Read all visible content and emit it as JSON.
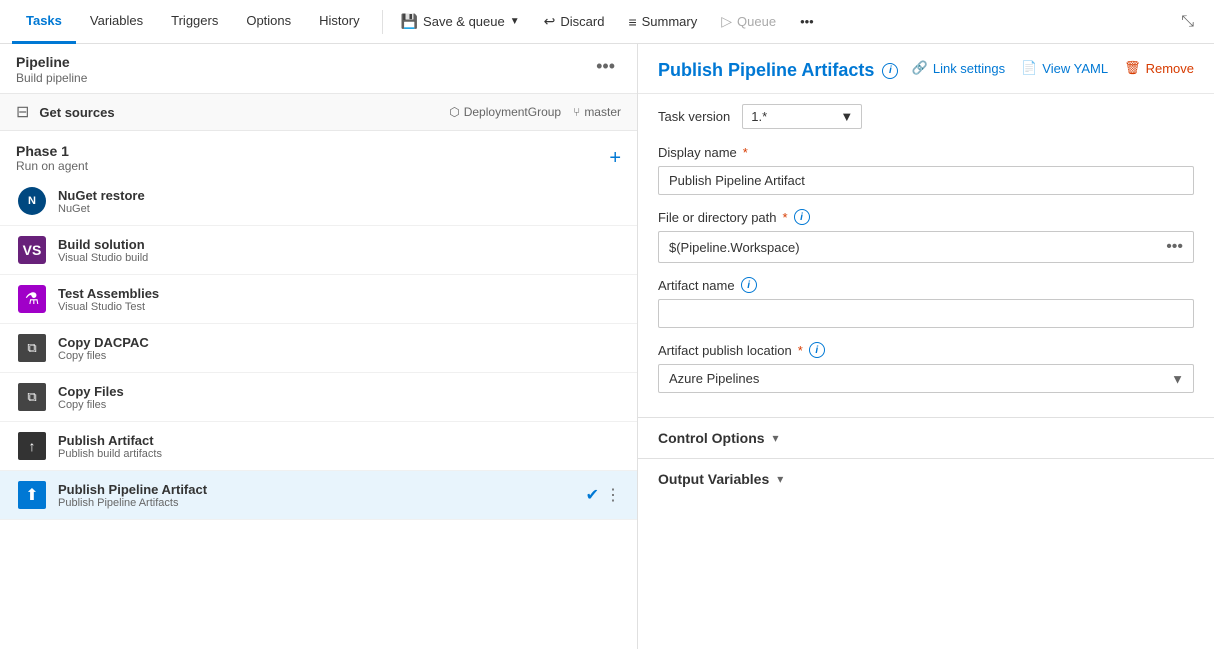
{
  "topNav": {
    "tabs": [
      {
        "id": "tasks",
        "label": "Tasks",
        "active": true
      },
      {
        "id": "variables",
        "label": "Variables",
        "active": false
      },
      {
        "id": "triggers",
        "label": "Triggers",
        "active": false
      },
      {
        "id": "options",
        "label": "Options",
        "active": false
      },
      {
        "id": "history",
        "label": "History",
        "active": false
      }
    ],
    "actions": [
      {
        "id": "save-queue",
        "icon": "💾",
        "label": "Save & queue",
        "hasDropdown": true
      },
      {
        "id": "discard",
        "icon": "↩",
        "label": "Discard"
      },
      {
        "id": "summary",
        "icon": "≡",
        "label": "Summary"
      },
      {
        "id": "queue",
        "icon": "▷",
        "label": "Queue"
      },
      {
        "id": "more",
        "icon": "···",
        "label": ""
      }
    ]
  },
  "leftPanel": {
    "pipeline": {
      "title": "Pipeline",
      "subtitle": "Build pipeline"
    },
    "getSources": {
      "label": "Get sources",
      "repo": "DeploymentGroup",
      "branch": "master"
    },
    "phase": {
      "title": "Phase 1",
      "subtitle": "Run on agent"
    },
    "tasks": [
      {
        "id": "nuget",
        "name": "NuGet restore",
        "sub": "NuGet",
        "iconType": "nuget"
      },
      {
        "id": "build",
        "name": "Build solution",
        "sub": "Visual Studio build",
        "iconType": "vs"
      },
      {
        "id": "test",
        "name": "Test Assemblies",
        "sub": "Visual Studio Test",
        "iconType": "flask"
      },
      {
        "id": "copy-dacpac",
        "name": "Copy DACPAC",
        "sub": "Copy files",
        "iconType": "copy"
      },
      {
        "id": "copy-files",
        "name": "Copy Files",
        "sub": "Copy files",
        "iconType": "copy"
      },
      {
        "id": "publish-artifact",
        "name": "Publish Artifact",
        "sub": "Publish build artifacts",
        "iconType": "publish"
      },
      {
        "id": "publish-pipeline",
        "name": "Publish Pipeline Artifact",
        "sub": "Publish Pipeline Artifacts",
        "iconType": "publish-pipeline",
        "active": true
      }
    ]
  },
  "rightPanel": {
    "title": "Publish Pipeline Artifacts",
    "infoIcon": "i",
    "actions": {
      "linkSettings": "Link settings",
      "viewYaml": "View YAML",
      "remove": "Remove"
    },
    "taskVersionLabel": "Task version",
    "taskVersionValue": "1.*",
    "fields": {
      "displayName": {
        "label": "Display name",
        "required": true,
        "value": "Publish Pipeline Artifact"
      },
      "fileDirectoryPath": {
        "label": "File or directory path",
        "required": true,
        "value": "$(Pipeline.Workspace)",
        "hasInfoIcon": true
      },
      "artifactName": {
        "label": "Artifact name",
        "required": false,
        "value": "",
        "hasInfoIcon": true
      },
      "artifactPublishLocation": {
        "label": "Artifact publish location",
        "required": true,
        "value": "Azure Pipelines",
        "hasInfoIcon": true
      }
    },
    "sections": {
      "controlOptions": "Control Options",
      "outputVariables": "Output Variables"
    }
  }
}
